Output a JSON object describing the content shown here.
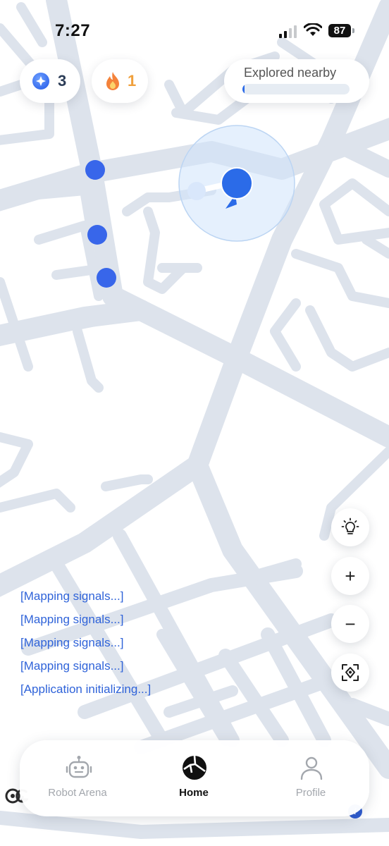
{
  "status_bar": {
    "time": "7:27",
    "battery_level": "87"
  },
  "stats": {
    "gems_count": "3",
    "streak_count": "1",
    "gem_icon": "gem-icon",
    "streak_icon": "flame-icon"
  },
  "explored": {
    "title": "Explored nearby",
    "progress_fraction": 0.02
  },
  "map_controls": {
    "tip_icon": "lightbulb-icon",
    "zoom_in_label": "+",
    "zoom_out_label": "−",
    "recenter_icon": "recenter-icon"
  },
  "log": [
    "[Mapping signals...]",
    "[Mapping signals...]",
    "[Mapping signals...]",
    "[Mapping signals...]",
    "[Application initializing...]"
  ],
  "tabs": [
    {
      "label": "Robot Arena",
      "icon": "robot-icon",
      "active": false
    },
    {
      "label": "Home",
      "icon": "home-map-icon",
      "active": true
    },
    {
      "label": "Profile",
      "icon": "person-icon",
      "active": false
    }
  ],
  "colors": {
    "map_background": "#ffffff",
    "road": "#dde3ec",
    "accent_blue": "#2b6be8",
    "log_text": "#2f63d9",
    "streak_orange": "#f0a03c"
  }
}
